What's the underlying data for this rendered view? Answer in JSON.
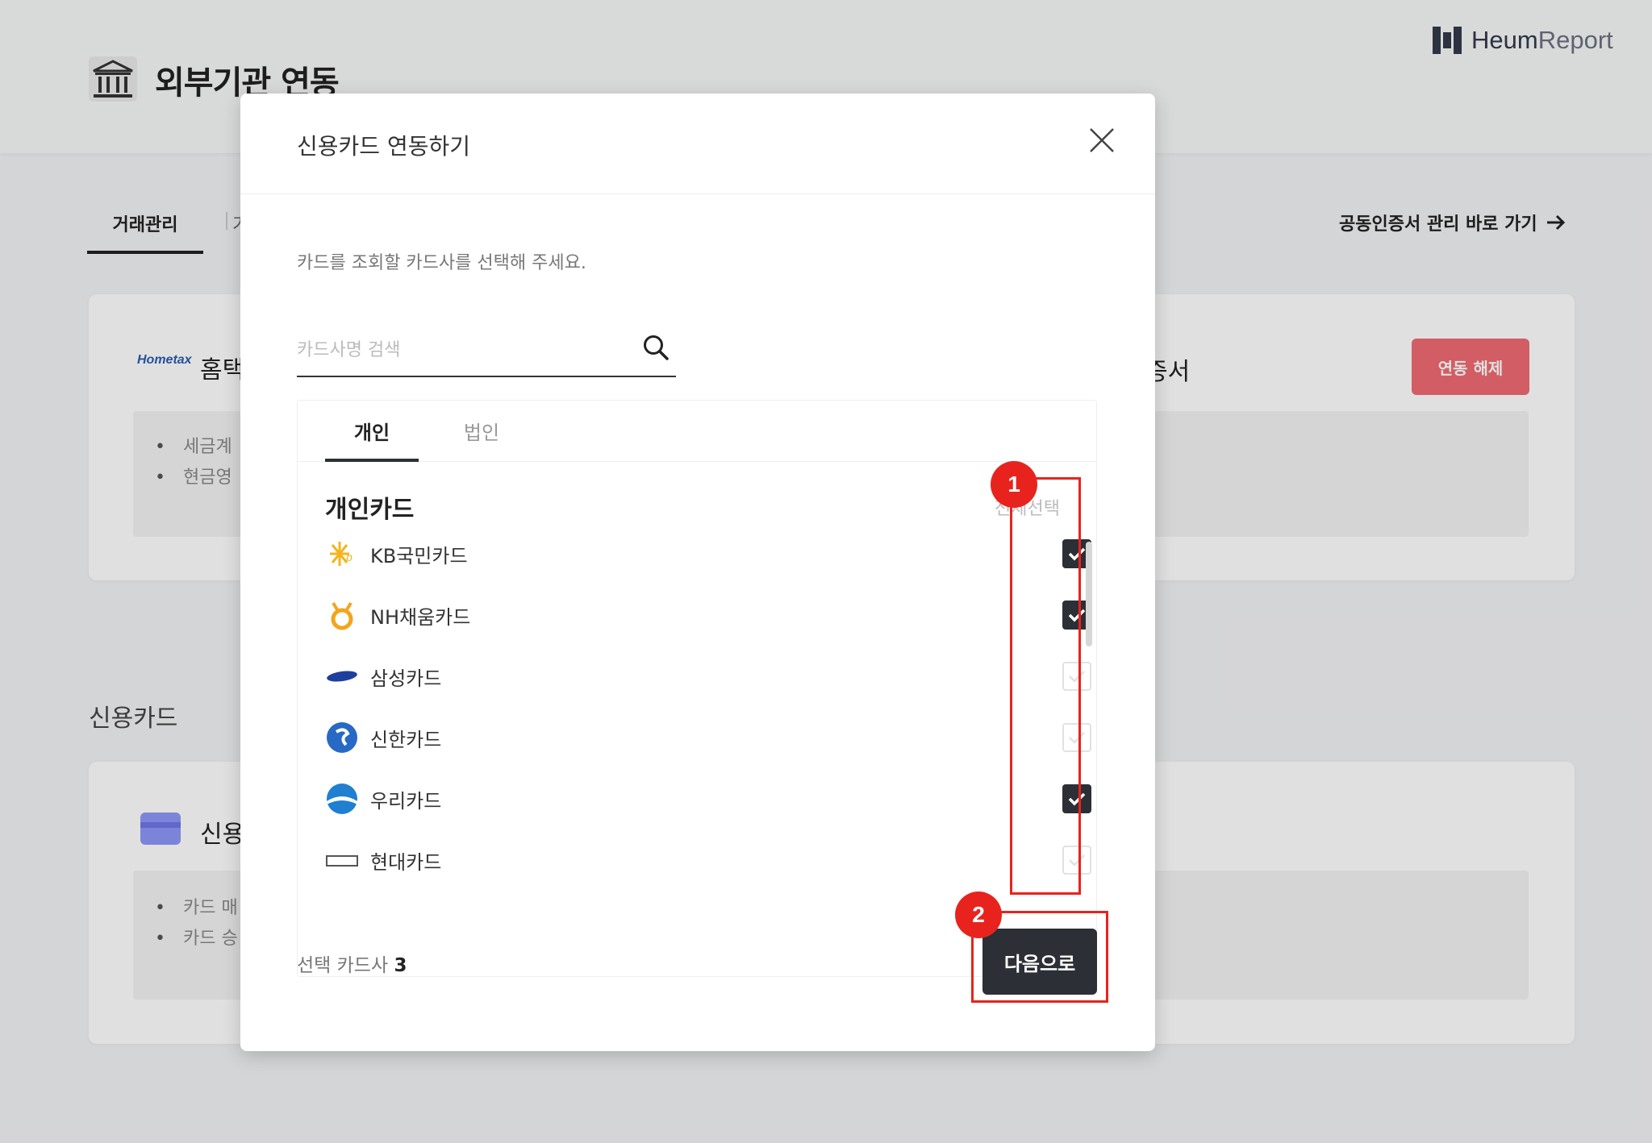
{
  "page": {
    "title": "외부기관 연동",
    "logo_main": "Heum",
    "logo_thin": "Report",
    "tabs": [
      "거래관리",
      "기"
    ],
    "cert_link": "공동인증서 관리 바로 가기",
    "hometax": {
      "logo_text": "Hometax",
      "label": "홈택",
      "label_suffix": "증서",
      "unlink_button": "연동 해제",
      "bullets": [
        "세금계",
        "현금영"
      ]
    },
    "credit_section": {
      "title": "신용카드",
      "label": "신용",
      "bullets": [
        "카드 매",
        "카드 승"
      ]
    }
  },
  "modal": {
    "title": "신용카드 연동하기",
    "instruction": "카드를 조회할 카드사를 선택해 주세요.",
    "search_placeholder": "카드사명 검색",
    "tabs": [
      {
        "label": "개인",
        "active": true
      },
      {
        "label": "법인",
        "active": false
      }
    ],
    "group_title": "개인카드",
    "select_all": "전체선택",
    "cards": [
      {
        "name": "KB국민카드",
        "checked": true,
        "icon": "kb-logo-icon"
      },
      {
        "name": "NH채움카드",
        "checked": true,
        "icon": "nh-logo-icon"
      },
      {
        "name": "삼성카드",
        "checked": false,
        "icon": "samsung-logo-icon"
      },
      {
        "name": "신한카드",
        "checked": false,
        "icon": "shinhan-logo-icon"
      },
      {
        "name": "우리카드",
        "checked": true,
        "icon": "woori-logo-icon"
      },
      {
        "name": "현대카드",
        "checked": false,
        "icon": "hyundai-logo-icon"
      }
    ],
    "selected_label": "선택 카드사",
    "selected_count": "3",
    "next_button": "다음으로"
  },
  "annotations": [
    {
      "number": "1"
    },
    {
      "number": "2"
    }
  ],
  "colors": {
    "dark": "#2d2f36",
    "danger": "#f06a72",
    "annotation": "#e8231e"
  }
}
